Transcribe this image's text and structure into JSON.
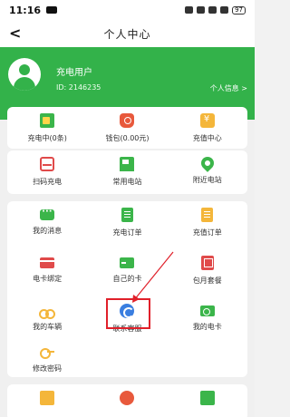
{
  "status_bar": {
    "time": "11:16",
    "battery": "97"
  },
  "nav": {
    "back_glyph": "<",
    "title": "个人中心"
  },
  "profile": {
    "name": "充电用户",
    "id_label": "ID: 2146235",
    "info_link": "个人信息 >"
  },
  "account_row": [
    {
      "icon": "battery-icon",
      "label": "充电中(0条)"
    },
    {
      "icon": "wallet-icon",
      "label": "钱包(0.00元)"
    },
    {
      "icon": "recharge-icon",
      "label": "充值中心"
    }
  ],
  "quick_row": [
    {
      "icon": "scan-icon",
      "label": "扫码充电"
    },
    {
      "icon": "station-icon",
      "label": "常用电站"
    },
    {
      "icon": "location-icon",
      "label": "附近电站"
    }
  ],
  "menu_rows": [
    [
      {
        "icon": "message-icon",
        "label": "我的消息"
      },
      {
        "icon": "order-icon",
        "label": "充电订单"
      },
      {
        "icon": "recharge-order-icon",
        "label": "充值订单"
      }
    ],
    [
      {
        "icon": "card-bind-icon",
        "label": "电卡绑定"
      },
      {
        "icon": "my-cards-icon",
        "label": "自己的卡"
      },
      {
        "icon": "package-icon",
        "label": "包月套餐"
      }
    ],
    [
      {
        "icon": "vehicle-icon",
        "label": "我的车辆"
      },
      {
        "icon": "customer-service-icon",
        "label": "联系客服"
      },
      {
        "icon": "ecard-icon",
        "label": "我的电卡"
      }
    ],
    [
      {
        "icon": "password-icon",
        "label": "修改密码"
      }
    ]
  ],
  "colors": {
    "brand_green": "#33b24a",
    "highlight_red": "#e0202a"
  }
}
